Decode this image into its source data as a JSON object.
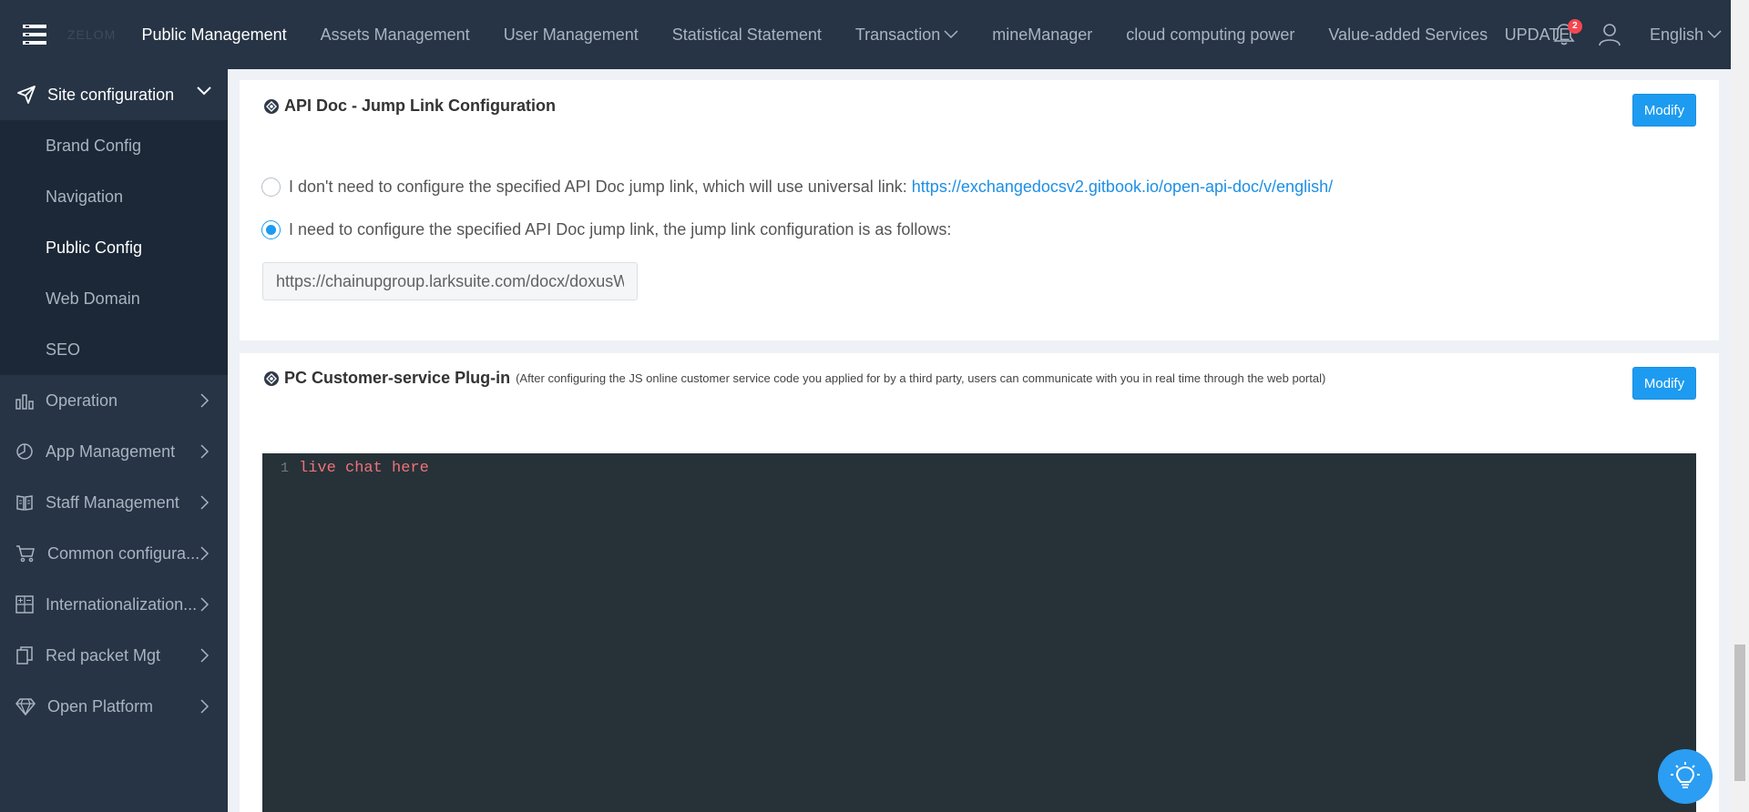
{
  "topbar": {
    "logo": "ZELOM",
    "nav": [
      {
        "label": "Public Management",
        "active": true
      },
      {
        "label": "Assets Management"
      },
      {
        "label": "User Management"
      },
      {
        "label": "Statistical Statement"
      },
      {
        "label": "Transaction",
        "dropdown": true
      },
      {
        "label": "mineManager"
      },
      {
        "label": "cloud computing power"
      },
      {
        "label": "Value-added Services"
      },
      {
        "label": "UPDATE"
      }
    ],
    "notifications": "2",
    "language": "English"
  },
  "sidebar": {
    "group": {
      "label": "Site configuration",
      "icon": "send-icon",
      "expanded": true
    },
    "subitems": [
      {
        "label": "Brand Config"
      },
      {
        "label": "Navigation"
      },
      {
        "label": "Public Config",
        "active": true
      },
      {
        "label": "Web Domain"
      },
      {
        "label": "SEO"
      }
    ],
    "items": [
      {
        "label": "Operation",
        "icon": "bar-chart-icon"
      },
      {
        "label": "App Management",
        "icon": "pie-chart-icon"
      },
      {
        "label": "Staff Management",
        "icon": "book-icon"
      },
      {
        "label": "Common configura...",
        "icon": "cart-icon"
      },
      {
        "label": "Internationalization...",
        "icon": "calculator-icon"
      },
      {
        "label": "Red packet Mgt",
        "icon": "copy-icon"
      },
      {
        "label": "Open Platform",
        "icon": "diamond-icon"
      }
    ]
  },
  "api_doc": {
    "title": "API Doc - Jump Link Configuration",
    "modify_label": "Modify",
    "option1": "I don't need to configure the specified API Doc jump link, which will use universal link:",
    "option1_link": "https://exchangedocsv2.gitbook.io/open-api-doc/v/english/",
    "option2": "I need to configure the specified API Doc jump link, the jump link configuration is as follows:",
    "selected_option": 2,
    "link_value": "https://chainupgroup.larksuite.com/docx/doxusW"
  },
  "plugin": {
    "title": "PC Customer-service Plug-in",
    "note": "(After configuring the JS online customer service code you applied for by a third party, users can communicate with you in real time through the web portal)",
    "modify_label": "Modify",
    "line_number": "1",
    "code": "live chat here"
  },
  "colors": {
    "topbar": "#263445",
    "accent": "#1d9bf0",
    "editor_bg": "#263238",
    "code_text": "#f07178"
  }
}
